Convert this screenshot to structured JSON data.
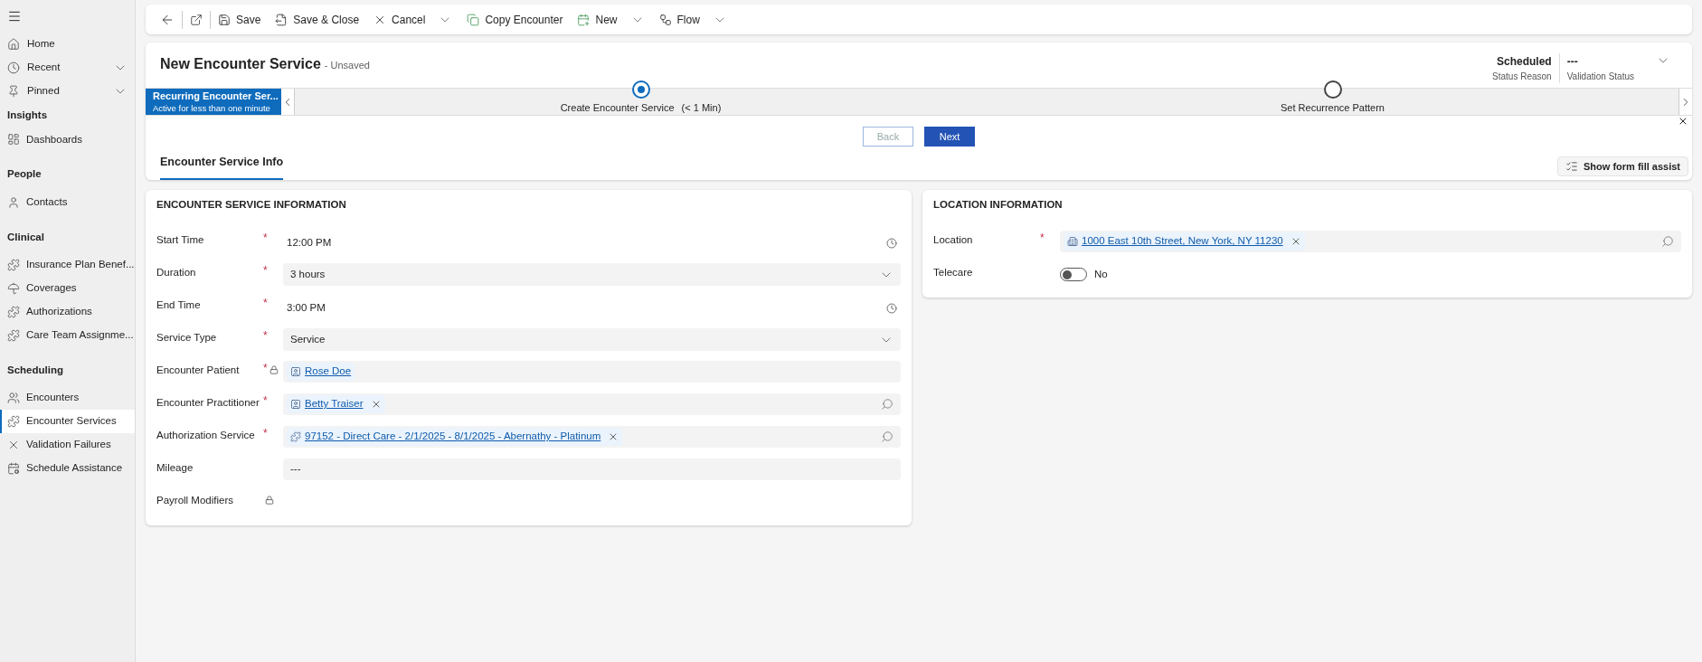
{
  "sidebar": {
    "top": [
      {
        "label": "Home",
        "expandable": false
      },
      {
        "label": "Recent",
        "expandable": true
      },
      {
        "label": "Pinned",
        "expandable": true
      }
    ],
    "groups": [
      {
        "title": "Insights",
        "items": [
          {
            "label": "Dashboards",
            "selected": false
          }
        ]
      },
      {
        "title": "People",
        "items": [
          {
            "label": "Contacts",
            "selected": false
          }
        ]
      },
      {
        "title": "Clinical",
        "items": [
          {
            "label": "Insurance Plan Benef...",
            "selected": false
          },
          {
            "label": "Coverages",
            "selected": false
          },
          {
            "label": "Authorizations",
            "selected": false
          },
          {
            "label": "Care Team Assignme...",
            "selected": false
          }
        ]
      },
      {
        "title": "Scheduling",
        "items": [
          {
            "label": "Encounters",
            "selected": false
          },
          {
            "label": "Encounter Services",
            "selected": true
          },
          {
            "label": "Validation Failures",
            "selected": false
          },
          {
            "label": "Schedule Assistance",
            "selected": false
          }
        ]
      }
    ]
  },
  "toolbar": [
    {
      "label": "Save",
      "dropdown": false
    },
    {
      "label": "Save & Close",
      "dropdown": false
    },
    {
      "label": "Cancel",
      "dropdown": true
    },
    {
      "label": "Copy Encounter",
      "dropdown": false
    },
    {
      "label": "New",
      "dropdown": true
    },
    {
      "label": "Flow",
      "dropdown": true
    }
  ],
  "header": {
    "title": "New Encounter Service",
    "save_state": "- Unsaved",
    "fields": [
      {
        "value": "Scheduled",
        "label": "Status Reason"
      },
      {
        "value": "---",
        "label": "Validation Status"
      }
    ]
  },
  "process": {
    "flag": {
      "title": "Recurring Encounter Ser...",
      "subtitle": "Active for less than one minute"
    },
    "stages": [
      {
        "label": "Create Encounter Service",
        "duration": "(< 1 Min)",
        "selected": true
      },
      {
        "label": "Set Recurrence Pattern",
        "selected": false
      }
    ],
    "buttons": [
      {
        "label": "Back",
        "disabled": true
      },
      {
        "label": "Next",
        "disabled": false
      }
    ]
  },
  "tabs": [
    {
      "label": "Encounter Service Info",
      "selected": true
    }
  ],
  "form_fill_assist": "Show form fill assist",
  "sections": [
    {
      "title": "ENCOUNTER SERVICE INFORMATION",
      "fields": [
        {
          "label": "Start Time",
          "required_mark": "*",
          "locked": false,
          "kind": "time",
          "value": "12:00 PM"
        },
        {
          "label": "Duration",
          "required_mark": "*",
          "locked": false,
          "kind": "select",
          "value": "3 hours"
        },
        {
          "label": "End Time",
          "required_mark": "*",
          "locked": false,
          "kind": "time",
          "value": "3:00 PM"
        },
        {
          "label": "Service Type",
          "required_mark": "*",
          "locked": false,
          "kind": "select",
          "value": "Service"
        },
        {
          "label": "Encounter Patient",
          "required_mark": "*",
          "locked": true,
          "kind": "lookup",
          "value": "Rose Doe",
          "removable": false,
          "searchable": false
        },
        {
          "label": "Encounter Practitioner",
          "required_mark": "*",
          "locked": false,
          "kind": "lookup",
          "value": "Betty Traiser",
          "removable": true,
          "searchable": true
        },
        {
          "label": "Authorization Service",
          "required_mark": "*",
          "locked": false,
          "kind": "lookup",
          "value": "97152 - Direct Care - 2/1/2025 - 8/1/2025 - Abernathy - Platinum",
          "removable": true,
          "searchable": true
        },
        {
          "label": "Mileage",
          "locked": false,
          "kind": "text",
          "value": "---"
        },
        {
          "label": "Payroll Modifiers",
          "locked": true,
          "kind": "empty"
        }
      ]
    },
    {
      "title": "LOCATION INFORMATION",
      "fields": [
        {
          "label": "Location",
          "required_mark": "*",
          "locked": false,
          "kind": "lookup",
          "value": "1000 East 10th Street, New York, NY 11230",
          "removable": true,
          "searchable": true
        },
        {
          "label": "Telecare",
          "locked": false,
          "kind": "toggle",
          "on": false,
          "value": "No"
        }
      ]
    }
  ]
}
